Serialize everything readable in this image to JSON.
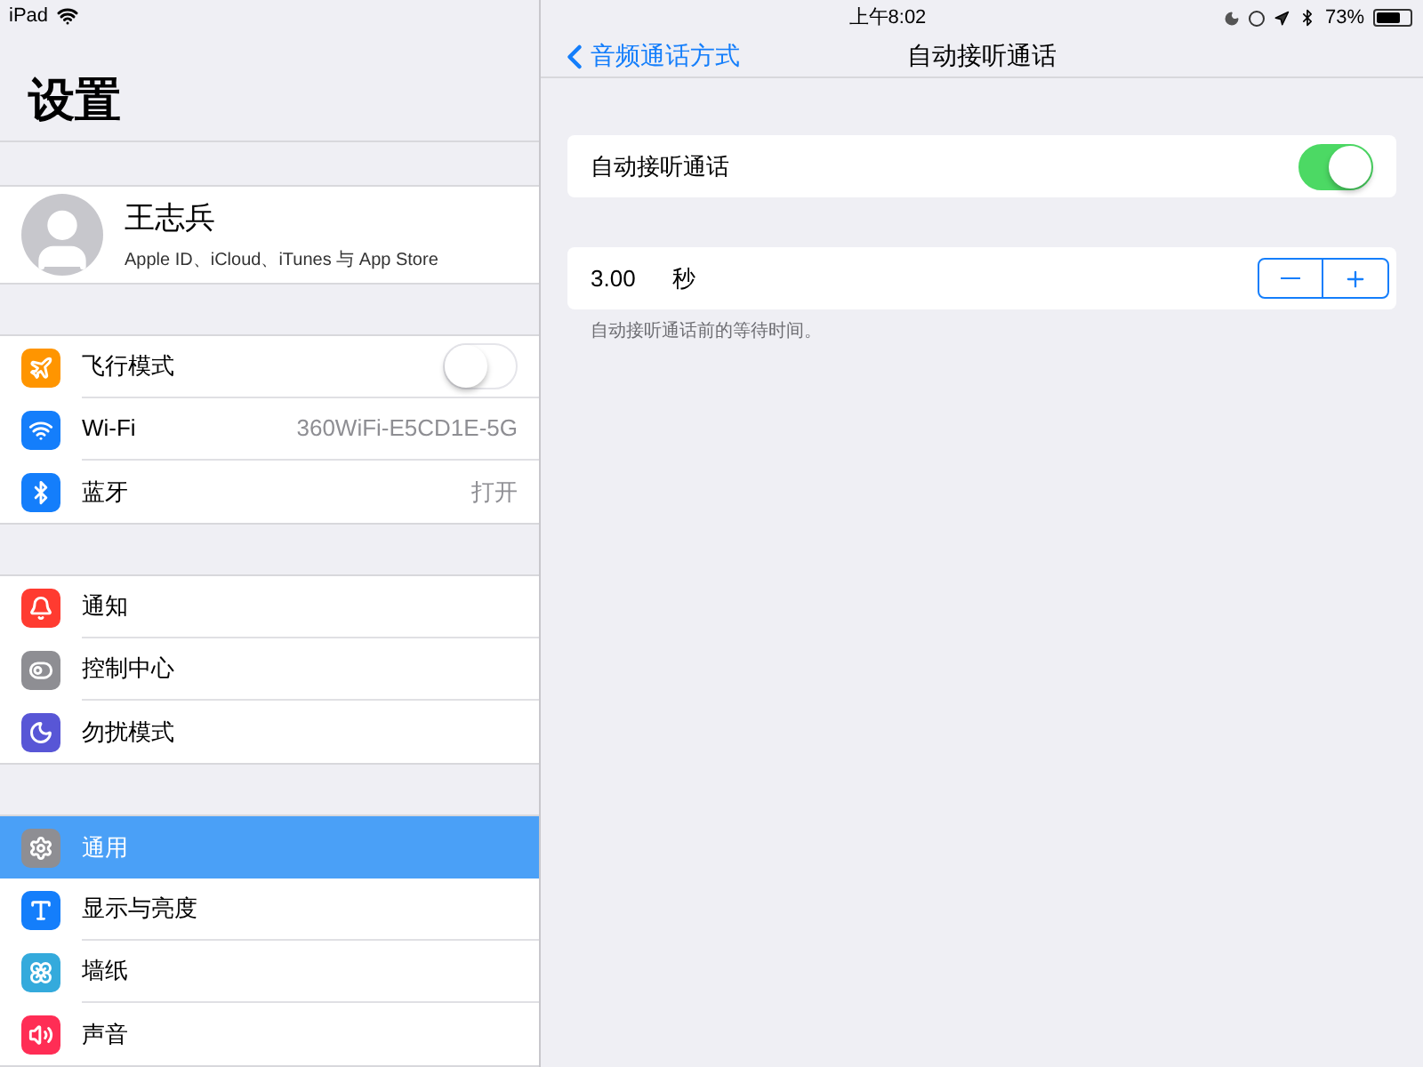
{
  "status_bar": {
    "device": "iPad",
    "time": "上午8:02",
    "battery": "73%"
  },
  "sidebar": {
    "title": "设置",
    "profile": {
      "name": "王志兵",
      "subtitle": "Apple ID、iCloud、iTunes 与 App Store"
    },
    "groups": [
      [
        {
          "label": "飞行模式",
          "kind": "toggle",
          "on": false,
          "color": "#ff9500",
          "selected": false
        },
        {
          "label": "Wi-Fi",
          "kind": "value",
          "value": "360WiFi-E5CD1E-5G",
          "color": "#147efb",
          "selected": false
        },
        {
          "label": "蓝牙",
          "kind": "value",
          "value": "打开",
          "color": "#147efb",
          "selected": false
        }
      ],
      [
        {
          "label": "通知",
          "kind": "plain",
          "color": "#ff3b30",
          "selected": false
        },
        {
          "label": "控制中心",
          "kind": "plain",
          "color": "#8e8e93",
          "selected": false
        },
        {
          "label": "勿扰模式",
          "kind": "plain",
          "color": "#5856d6",
          "selected": false
        }
      ],
      [
        {
          "label": "通用",
          "kind": "plain",
          "color": "#8e8e93",
          "selected": true
        },
        {
          "label": "显示与亮度",
          "kind": "plain",
          "color": "#147efb",
          "selected": false
        },
        {
          "label": "墙纸",
          "kind": "plain",
          "color": "#34aadc",
          "selected": false
        },
        {
          "label": "声音",
          "kind": "plain",
          "color": "#ff2d55",
          "selected": false
        }
      ]
    ]
  },
  "detail": {
    "back": "音频通话方式",
    "title": "自动接听通话",
    "toggle": {
      "label": "自动接听通话",
      "on": true
    },
    "stepper": {
      "value": "3.00",
      "unit": "秒",
      "footer": "自动接听通话前的等待时间。"
    }
  }
}
